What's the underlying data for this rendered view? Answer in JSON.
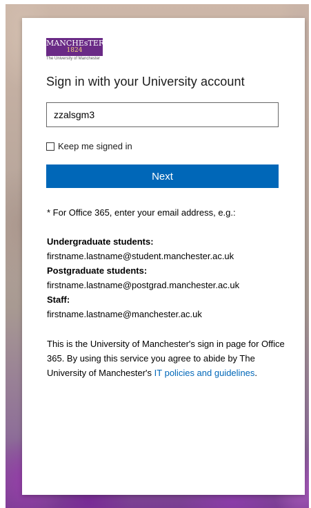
{
  "logo": {
    "name": "MANCHEsTER",
    "year": "1824",
    "subtitle": "The University of Manchester"
  },
  "title": "Sign in with your University account",
  "username": {
    "value": "zzalsgm3"
  },
  "keep_signed_in": {
    "label": "Keep me signed in",
    "checked": false
  },
  "next_button": "Next",
  "info": {
    "office_hint": "* For Office 365, enter your email address, e.g.:",
    "undergrad_label": "Undergraduate students:",
    "undergrad_example": "firstname.lastname@student.manchester.ac.uk",
    "postgrad_label": "Postgraduate students:",
    "postgrad_example": "firstname.lastname@postgrad.manchester.ac.uk",
    "staff_label": "Staff:",
    "staff_example": "firstname.lastname@manchester.ac.uk",
    "notice_text": "This is the University of Manchester's sign in page for Office 365. By using this service you agree to abide by The University of Manchester's ",
    "policy_link": "IT policies and guidelines",
    "notice_end": "."
  },
  "colors": {
    "accent": "#0067b8",
    "logo_purple": "#6a2a86"
  }
}
